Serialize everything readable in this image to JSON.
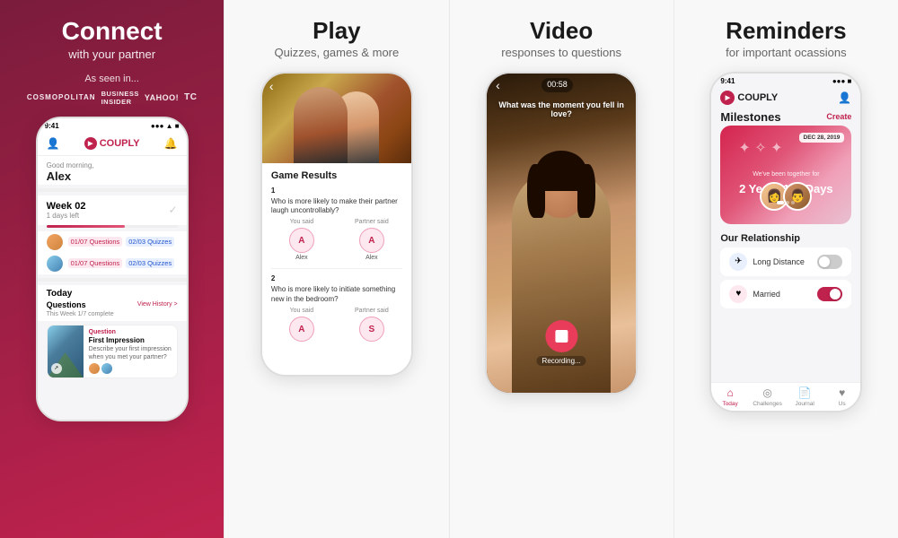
{
  "panel1": {
    "title": "Connect",
    "subtitle": "with your partner",
    "as_seen": "As seen in...",
    "brands": [
      "COSMOPOLITAN",
      "BUSINESS INSIDER",
      "yahoo! news",
      "TᴄC"
    ],
    "statusbar": {
      "time": "9:41",
      "signal": "●●●",
      "wifi": "▲",
      "battery": "■"
    },
    "logo": "COUPLY",
    "greeting_small": "Good morning,",
    "greeting_name": "Alex",
    "week": "Week 02",
    "days_left": "1 days left",
    "user1_stats": {
      "questions": "01/07 Questions",
      "quizzes": "02/03 Quizzes"
    },
    "user2_stats": {
      "questions": "01/07 Questions",
      "quizzes": "02/03 Quizzes"
    },
    "today": "Today",
    "questions_label": "Questions",
    "view_history": "View History >",
    "this_week": "This Week 1/7 complete",
    "question_label": "Question",
    "question_title": "First Impression",
    "question_desc": "Describe your first impression when you met your partner?"
  },
  "panel2": {
    "title": "Play",
    "subtitle": "Quizzes, games & more",
    "game_results": "Game Results",
    "q1_num": "1",
    "q1_text": "Who is more likely to make their partner laugh uncontrollably?",
    "q1_you_said": "You said",
    "q1_partner_said": "Partner said",
    "q1_you_answer": "A",
    "q1_partner_answer": "A",
    "q1_you_name": "Alex",
    "q1_partner_name": "Alex",
    "q2_num": "2",
    "q2_text": "Who is more likely to initiate something new in the bedroom?",
    "q2_you_said": "You said",
    "q2_partner_said": "Partner said",
    "q2_you_answer": "A",
    "q2_partner_answer": "S"
  },
  "panel3": {
    "title": "Video",
    "subtitle": "responses to questions",
    "timer": "00:58",
    "question_text": "What was the moment you fell in love?",
    "recording": "Recording..."
  },
  "panel4": {
    "title": "Reminders",
    "subtitle": "for important ocassions",
    "logo": "COUPLY",
    "milestones_label": "Milestones",
    "create_label": "Create",
    "date_badge": "DEC 28, 2019",
    "together_text": "We've been together for",
    "duration": "2 Years 112 Days",
    "our_relationship": "Our Relationship",
    "long_distance_label": "Long Distance",
    "married_label": "Married",
    "nav_today": "Today",
    "nav_challenges": "Challenges",
    "nav_journal": "Journal",
    "nav_us": "Us"
  }
}
